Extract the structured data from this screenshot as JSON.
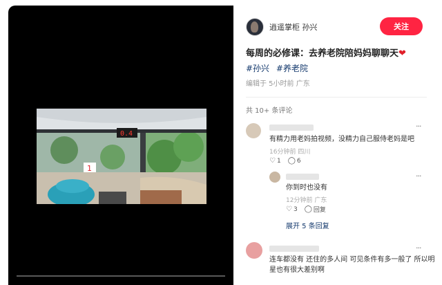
{
  "author": {
    "name": "逍遥掌柜 孙兴"
  },
  "follow_label": "关注",
  "note": {
    "title": "每周的必修课：去养老院陪妈妈聊聊天",
    "heart": "❤",
    "tags": [
      "#孙兴",
      "#养老院"
    ],
    "meta": "编辑于 5小时前 广东"
  },
  "comments_count": "共 10+ 条评论",
  "comments": [
    {
      "text": "有精力用老妈拍视频，没精力自己服侍老妈是吧",
      "meta": "16分钟前 四川",
      "likes": "1",
      "replies": "6"
    },
    {
      "text": "你到时也没有",
      "meta": "12分钟前 广东",
      "likes": "3",
      "reply_label": "回复"
    },
    {
      "text1": "连车都没有 还住的多人间 可见条件有多一般了 所以明",
      "text2": "星也有很大差别啊"
    }
  ],
  "expand_label": "展开 5 条回复",
  "icons": {
    "like": "heart-outline-icon",
    "comment": "comment-bubble-icon",
    "more": "more-dots-icon",
    "play": "video-progress-bar"
  },
  "colors": {
    "accent": "#ff2442",
    "tag": "#13386c"
  },
  "video": {
    "overlay_number": "1",
    "display_digits": "0.4"
  }
}
